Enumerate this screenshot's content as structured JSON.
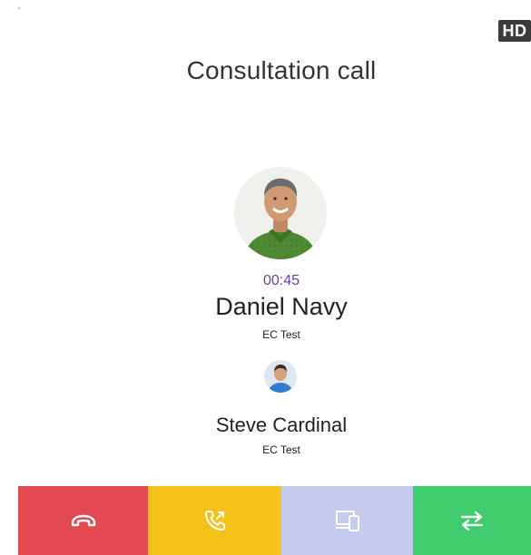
{
  "hd_badge": "HD",
  "title": "Consultation call",
  "call": {
    "timer": "00:45",
    "active_party": {
      "name": "Daniel Navy",
      "subtitle": "EC Test"
    },
    "held_party": {
      "name": "Steve Cardinal",
      "subtitle": "EC Test"
    }
  },
  "actions": [
    {
      "name": "hangup",
      "icon": "hangup-icon",
      "color": "#e24a4f"
    },
    {
      "name": "call-forward",
      "icon": "phone-forward-icon",
      "color": "#f5c21b"
    },
    {
      "name": "switch-device",
      "icon": "devices-icon",
      "color": "#c5cbee"
    },
    {
      "name": "transfer",
      "icon": "transfer-arrows-icon",
      "color": "#3fcc6c"
    }
  ],
  "colors": {
    "timer": "#6b3fa0",
    "text": "#222222"
  }
}
